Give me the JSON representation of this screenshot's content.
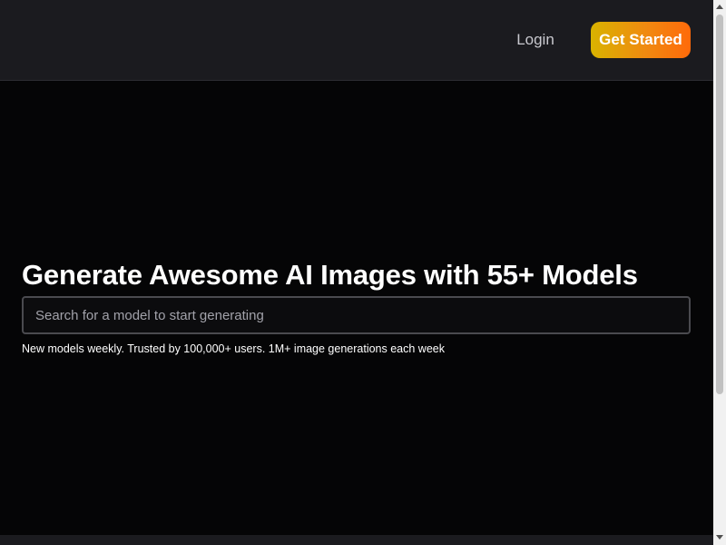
{
  "nav": {
    "login_label": "Login",
    "get_started_label": "Get Started"
  },
  "hero": {
    "title": "Generate Awesome AI Images with 55+ Models",
    "search_placeholder": "Search for a model to start generating",
    "tagline": "New models weekly. Trusted by 100,000+ users. 1M+ image generations each week"
  },
  "colors": {
    "background": "#050506",
    "navbar": "#1b1b1f",
    "cta_gradient_start": "#d9b300",
    "cta_gradient_end": "#ff6a0a",
    "text_primary": "#ffffff"
  }
}
